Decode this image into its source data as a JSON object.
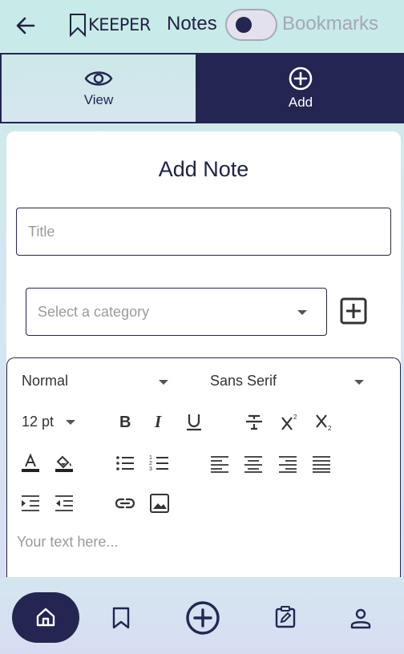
{
  "header": {
    "logo_text": "KEEPER",
    "notes_label": "Notes",
    "bookmarks_label": "Bookmarks",
    "toggle_on": false
  },
  "tabs": [
    {
      "label": "View",
      "icon": "eye-icon",
      "active": false
    },
    {
      "label": "Add",
      "icon": "plus-circle-icon",
      "active": true
    }
  ],
  "form": {
    "heading": "Add Note",
    "title_placeholder": "Title",
    "category_placeholder": "Select a category"
  },
  "editor": {
    "format": "Normal",
    "font": "Sans Serif",
    "size": "12 pt",
    "placeholder": "Your text here..."
  },
  "bottom_nav": [
    "home-icon",
    "bookmark-icon",
    "add-circle-icon",
    "clipboard-edit-icon",
    "profile-icon"
  ],
  "colors": {
    "navy": "#232650",
    "header_bg": "#c8eae8",
    "muted": "#a4a8b4"
  }
}
